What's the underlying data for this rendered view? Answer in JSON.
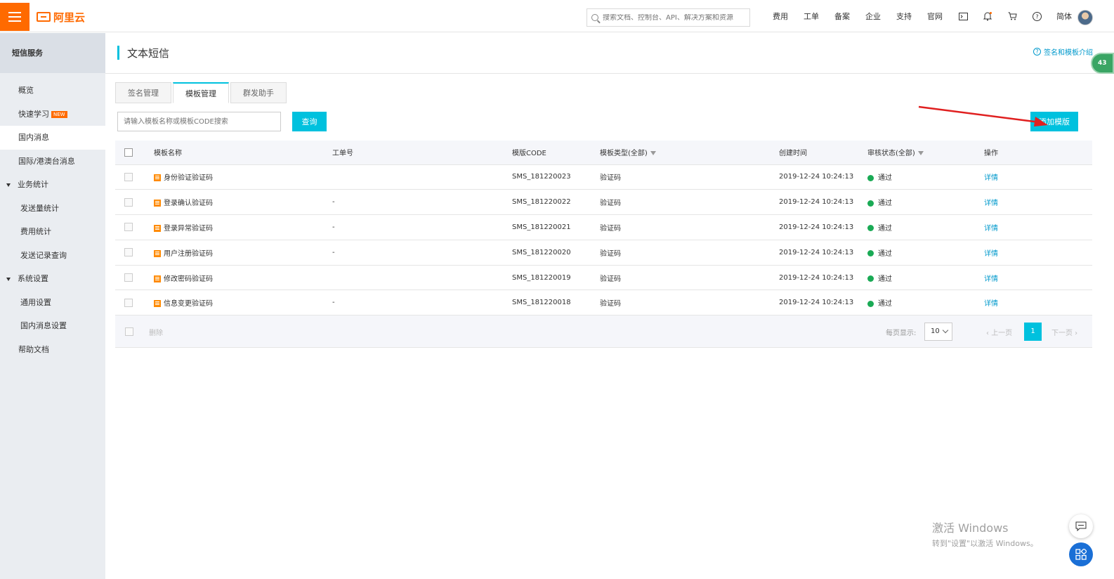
{
  "topbar": {
    "logo_text": "阿里云",
    "search_placeholder": "搜索文档、控制台、API、解决方案和资源",
    "nav": [
      "费用",
      "工单",
      "备案",
      "企业",
      "支持",
      "官网"
    ],
    "lang": "简体",
    "icons": [
      "terminal-icon",
      "bell-icon",
      "cart-icon",
      "help-icon"
    ]
  },
  "sidebar": {
    "title": "短信服务",
    "items": [
      {
        "label": "概览"
      },
      {
        "label": "快速学习",
        "badge": "NEW"
      },
      {
        "label": "国内消息"
      },
      {
        "label": "国际/港澳台消息"
      }
    ],
    "group1": {
      "label": "业务统计",
      "items": [
        "发送量统计",
        "费用统计",
        "发送记录查询"
      ]
    },
    "group2": {
      "label": "系统设置",
      "items": [
        "通用设置",
        "国内消息设置"
      ]
    },
    "help": "帮助文档"
  },
  "page": {
    "title": "文本短信",
    "help_link": "签名和模板介绍",
    "badge": "43"
  },
  "tabs": [
    "签名管理",
    "模板管理",
    "群发助手"
  ],
  "filter": {
    "placeholder": "请输入模板名称或模板CODE搜索",
    "query_label": "查询",
    "add_label": "添加模版"
  },
  "table": {
    "headers": [
      "模板名称",
      "工单号",
      "模版CODE",
      "模板类型(全部)",
      "创建时间",
      "审核状态(全部)",
      "操作"
    ],
    "rows": [
      {
        "name": "身份验证验证码",
        "ticket": "",
        "code": "SMS_181220023",
        "type": "验证码",
        "created": "2019-12-24 10:24:13",
        "status": "通过",
        "action": "详情"
      },
      {
        "name": "登录确认验证码",
        "ticket": "-",
        "code": "SMS_181220022",
        "type": "验证码",
        "created": "2019-12-24 10:24:13",
        "status": "通过",
        "action": "详情"
      },
      {
        "name": "登录异常验证码",
        "ticket": "-",
        "code": "SMS_181220021",
        "type": "验证码",
        "created": "2019-12-24 10:24:13",
        "status": "通过",
        "action": "详情"
      },
      {
        "name": "用户注册验证码",
        "ticket": "-",
        "code": "SMS_181220020",
        "type": "验证码",
        "created": "2019-12-24 10:24:13",
        "status": "通过",
        "action": "详情"
      },
      {
        "name": "修改密码验证码",
        "ticket": "",
        "code": "SMS_181220019",
        "type": "验证码",
        "created": "2019-12-24 10:24:13",
        "status": "通过",
        "action": "详情"
      },
      {
        "name": "信息变更验证码",
        "ticket": "-",
        "code": "SMS_181220018",
        "type": "验证码",
        "created": "2019-12-24 10:24:13",
        "status": "通过",
        "action": "详情"
      }
    ]
  },
  "footer": {
    "delete_label": "删除",
    "per_page_label": "每页显示:",
    "per_page_value": "10",
    "prev_label": "上一页",
    "current_page": "1",
    "next_label": "下一页"
  },
  "watermark": {
    "line1": "激活 Windows",
    "line2": "转到\"设置\"以激活 Windows。"
  },
  "colors": {
    "brand": "#ff6a00",
    "accent": "#00c1de",
    "success": "#1aaa55",
    "link": "#0099cc"
  }
}
